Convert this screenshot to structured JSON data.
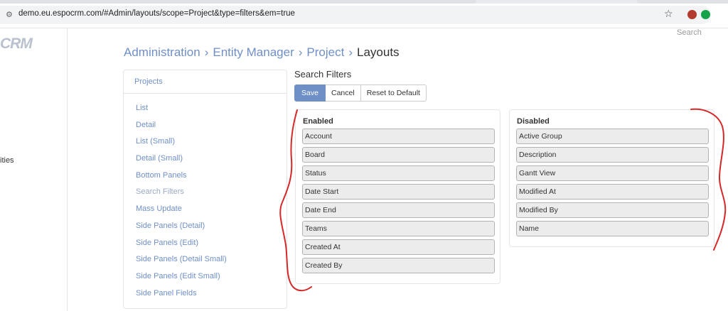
{
  "browser": {
    "url": "demo.eu.espocrm.com/#Admin/layouts/scope=Project&type=filters&em=true"
  },
  "app": {
    "logo": "CRM",
    "rail_text": "ities",
    "search_label": "Search"
  },
  "breadcrumb": {
    "items": [
      "Administration",
      "Entity Manager",
      "Project"
    ],
    "current": "Layouts",
    "separator": "›"
  },
  "menu": {
    "header": "Projects",
    "items": [
      {
        "label": "List"
      },
      {
        "label": "Detail"
      },
      {
        "label": "List (Small)"
      },
      {
        "label": "Detail (Small)"
      },
      {
        "label": "Bottom Panels"
      },
      {
        "label": "Search Filters",
        "active": true
      },
      {
        "label": "Mass Update"
      },
      {
        "label": "Side Panels (Detail)"
      },
      {
        "label": "Side Panels (Edit)"
      },
      {
        "label": "Side Panels (Detail Small)"
      },
      {
        "label": "Side Panels (Edit Small)"
      },
      {
        "label": "Side Panel Fields"
      }
    ]
  },
  "editor": {
    "title": "Search Filters",
    "buttons": {
      "save": "Save",
      "cancel": "Cancel",
      "reset": "Reset to Default"
    },
    "enabled": {
      "title": "Enabled",
      "fields": [
        "Account",
        "Board",
        "Status",
        "Date Start",
        "Date End",
        "Teams",
        "Created At",
        "Created By"
      ]
    },
    "disabled": {
      "title": "Disabled",
      "fields": [
        "Active Group",
        "Description",
        "Gantt View",
        "Modified At",
        "Modified By",
        "Name"
      ]
    }
  },
  "colors": {
    "accent": "#6f8fc7",
    "annotation": "#d62828"
  },
  "icons": {
    "site": "tune-icon",
    "bookmark": "star-icon"
  }
}
